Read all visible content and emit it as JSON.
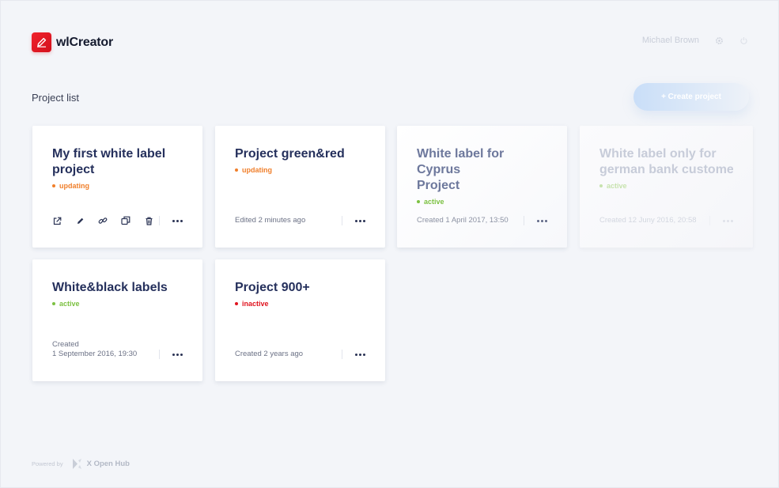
{
  "app": {
    "name": "wlCreator"
  },
  "user": {
    "name": "Michael Brown"
  },
  "page": {
    "title": "Project list",
    "create_label": "+ Create project"
  },
  "status_colors": {
    "updating": "#f07f2b",
    "active": "#7cc142",
    "inactive": "#e0131e"
  },
  "projects": [
    {
      "title_line1": "My first white label",
      "title_line2": "project",
      "status": "updating",
      "meta_line1": "",
      "meta_line2": ""
    },
    {
      "title_line1": "Project green&red",
      "title_line2": "",
      "status": "updating",
      "meta_line1": "Edited 2 minutes ago",
      "meta_line2": ""
    },
    {
      "title_line1": "White label for Cyprus",
      "title_line2": "Project",
      "status": "active",
      "meta_line1": "Created 1 April 2017, 13:50",
      "meta_line2": ""
    },
    {
      "title_line1": "White label only for",
      "title_line2": "german bank custome…",
      "status": "active",
      "meta_line1": "Created 12 Juny 2016, 20:58",
      "meta_line2": ""
    },
    {
      "title_line1": "White&black labels",
      "title_line2": "",
      "status": "active",
      "meta_line1": "Created",
      "meta_line2": "1 September 2016, 19:30"
    },
    {
      "title_line1": "Project 900+",
      "title_line2": "",
      "status": "inactive",
      "meta_line1": "Created 2 years ago",
      "meta_line2": ""
    }
  ],
  "footer": {
    "powered_by": "Powered by",
    "brand": "X Open Hub"
  },
  "icons": [
    "settings-icon",
    "logout-icon",
    "open-external-icon",
    "edit-icon",
    "link-icon",
    "duplicate-icon",
    "delete-icon",
    "more-icon"
  ]
}
